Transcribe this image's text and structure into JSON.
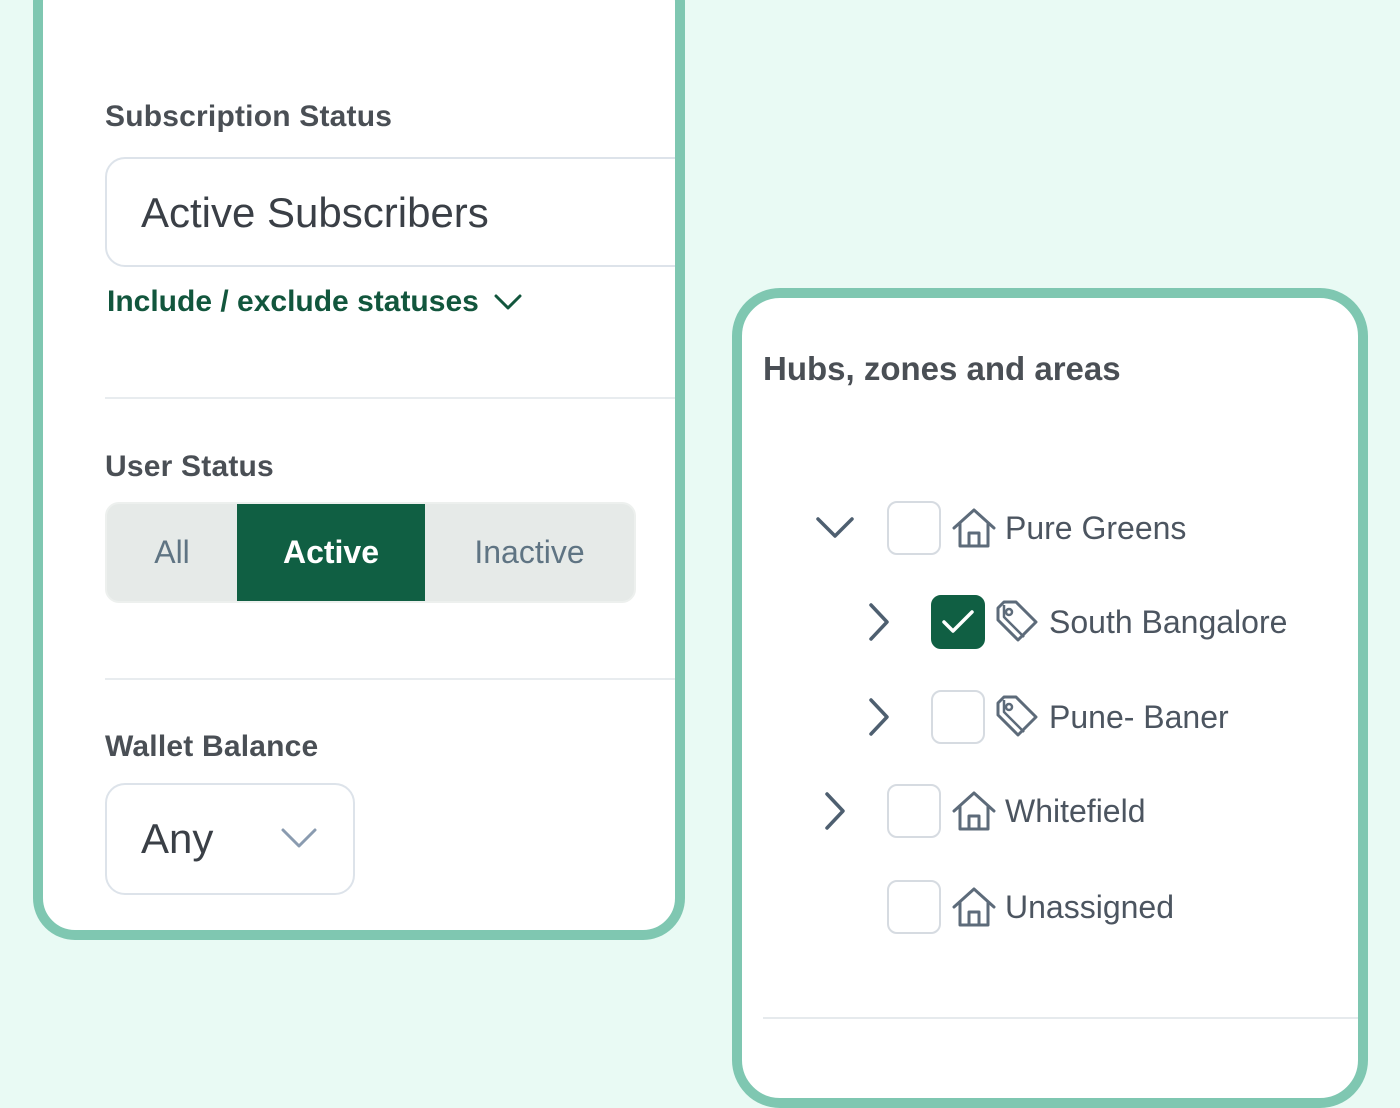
{
  "filters": {
    "subscription": {
      "label": "Subscription Status",
      "value": "Active Subscribers",
      "toggle_label": "Include / exclude statuses"
    },
    "user_status": {
      "label": "User Status",
      "options": [
        "All",
        "Active",
        "Inactive"
      ],
      "selected": "Active"
    },
    "wallet": {
      "label": "Wallet Balance",
      "value": "Any"
    }
  },
  "hubs": {
    "title": "Hubs, zones and areas",
    "tree": [
      {
        "label": "Pure Greens",
        "type": "hub",
        "icon": "house-icon",
        "expanded": true,
        "checked": false,
        "level": 0
      },
      {
        "label": "South Bangalore",
        "type": "zone",
        "icon": "tag-icon",
        "expanded": false,
        "checked": true,
        "level": 1
      },
      {
        "label": "Pune- Baner",
        "type": "zone",
        "icon": "tag-icon",
        "expanded": false,
        "checked": false,
        "level": 1
      },
      {
        "label": "Whitefield",
        "type": "hub",
        "icon": "house-icon",
        "expanded": false,
        "checked": false,
        "level": 0
      },
      {
        "label": "Unassigned",
        "type": "hub",
        "icon": "house-icon",
        "expanded": null,
        "checked": false,
        "level": 0
      }
    ]
  },
  "colors": {
    "background": "#e9faf4",
    "card_border": "#7fc7b1",
    "primary": "#105f43",
    "link": "#12563d",
    "icon": "#5d6b7a"
  }
}
